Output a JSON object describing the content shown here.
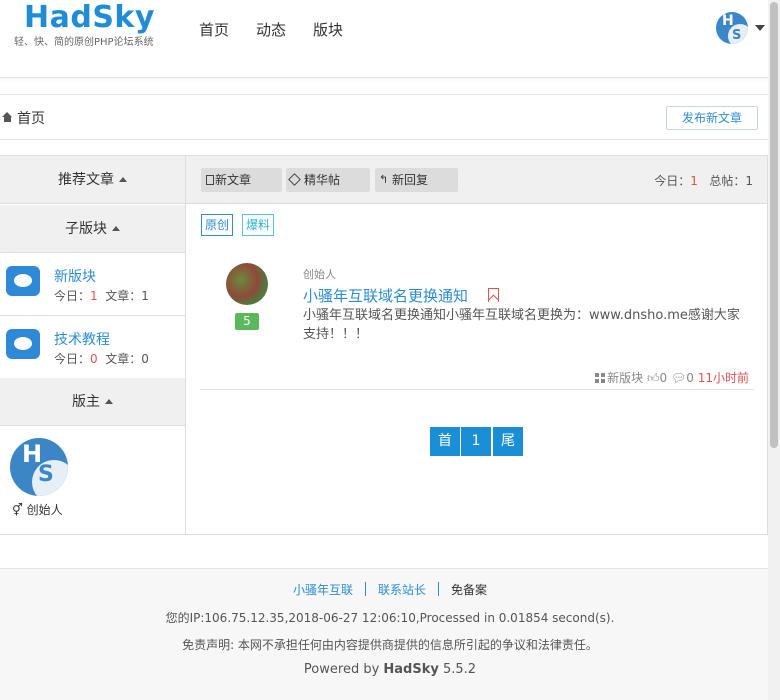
{
  "header": {
    "logo": "HadSky",
    "tagline": "轻、快、简的原创PHP论坛系统",
    "nav": [
      "首页",
      "动态",
      "版块"
    ],
    "user_avatar_letters": {
      "h": "H",
      "s": "S"
    }
  },
  "breadcrumb": {
    "home_icon": "home-icon",
    "label": "首页"
  },
  "publish_button": "发布新文章",
  "sidebar": {
    "recommend": "推荐文章",
    "sub_boards": "子版块",
    "boards": [
      {
        "name": "新版块",
        "today_label": "今日：",
        "today": "1",
        "articles_label": "  文章：",
        "articles": "1"
      },
      {
        "name": "技术教程",
        "today_label": "今日：",
        "today": "0",
        "articles_label": "  文章：",
        "articles": "0"
      }
    ],
    "moderator_head": "版主",
    "moderator": {
      "letters": {
        "h": "H",
        "s": "S"
      },
      "gender_icon": "⚥",
      "name": "创始人"
    }
  },
  "toolbar": {
    "tabs": [
      "新文章",
      "精华帖",
      "新回复"
    ],
    "today_label": "今日：",
    "today": "1",
    "total_label": "   总帖：",
    "total": "1"
  },
  "tags": [
    "原创",
    "爆料"
  ],
  "post": {
    "author": "创始人",
    "level": "5",
    "title": "小骚年互联域名更换通知",
    "body": "小骚年互联域名更换通知小骚年互联域名更换为：www.dnsho.me感谢大家支持！！！",
    "board": "新版块",
    "likes": "0",
    "comments": "0",
    "time": "11小时前"
  },
  "pagination": [
    "首",
    "1",
    "尾"
  ],
  "footer": {
    "links": [
      "小骚年互联",
      "联系站长",
      "免备案"
    ],
    "ip_line": "您的IP:106.75.12.35,2018-06-27 12:06:10,Processed in 0.01854 second(s).",
    "disclaimer": "免责声明: 本网不承担任何由内容提供商提供的信息所引起的争议和法律责任。",
    "powered_prefix": "Powered by ",
    "powered_name": "HadSky",
    "version": " 5.5.2"
  },
  "colors": {
    "accent": "#1b8ed8",
    "link": "#2d8cd2",
    "red": "#d9534f",
    "level_badge": "#5cb85c"
  }
}
